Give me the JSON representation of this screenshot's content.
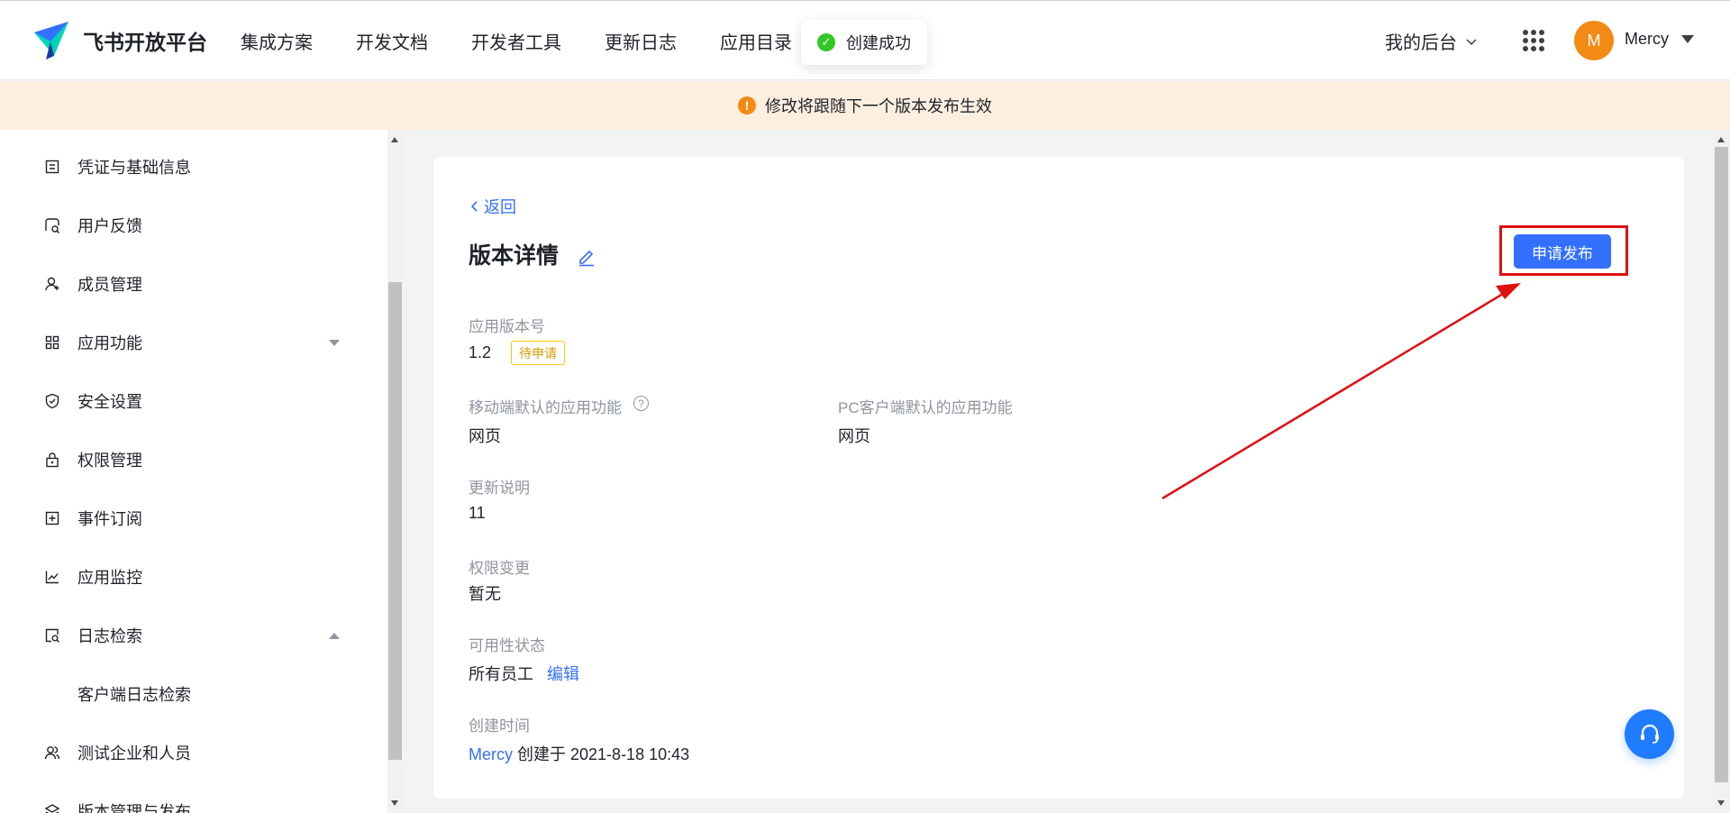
{
  "header": {
    "logo_text": "飞书开放平台",
    "nav": [
      "集成方案",
      "开发文档",
      "开发者工具",
      "更新日志",
      "应用目录"
    ],
    "toast": "创建成功",
    "backend_label": "我的后台",
    "avatar_letter": "M",
    "user_name": "Mercy"
  },
  "notice": {
    "icon": "!",
    "text": "修改将跟随下一个版本发布生效"
  },
  "sidebar": {
    "items": [
      {
        "label": "凭证与基础信息",
        "icon": "credential-icon"
      },
      {
        "label": "用户反馈",
        "icon": "feedback-icon"
      },
      {
        "label": "成员管理",
        "icon": "member-icon"
      },
      {
        "label": "应用功能",
        "icon": "app-features-icon"
      },
      {
        "label": "安全设置",
        "icon": "shield-icon"
      },
      {
        "label": "权限管理",
        "icon": "lock-icon"
      },
      {
        "label": "事件订阅",
        "icon": "event-icon"
      },
      {
        "label": "应用监控",
        "icon": "chart-icon"
      },
      {
        "label": "日志检索",
        "icon": "log-search-icon"
      },
      {
        "label": "客户端日志检索",
        "icon": ""
      },
      {
        "label": "测试企业和人员",
        "icon": "users-icon"
      },
      {
        "label": "版本管理与发布",
        "icon": "layers-icon"
      }
    ]
  },
  "main": {
    "back_label": "返回",
    "title": "版本详情",
    "apply_button": "申请发布",
    "fields": {
      "version_label": "应用版本号",
      "version_value": "1.2",
      "version_badge": "待申请",
      "mobile_label": "移动端默认的应用功能",
      "mobile_help": "?",
      "mobile_value": "网页",
      "pc_label": "PC客户端默认的应用功能",
      "pc_value": "网页",
      "notes_label": "更新说明",
      "notes_value": "11",
      "perm_label": "权限变更",
      "perm_value": "暂无",
      "avail_label": "可用性状态",
      "avail_value": "所有员工",
      "avail_edit": "编辑",
      "created_label": "创建时间",
      "created_user": "Mercy",
      "created_text": "创建于 2021-8-18 10:43"
    }
  },
  "colors": {
    "accent": "#3370ff",
    "warning": "#f28a14",
    "success": "#34c724",
    "annotation": "#e01010"
  }
}
